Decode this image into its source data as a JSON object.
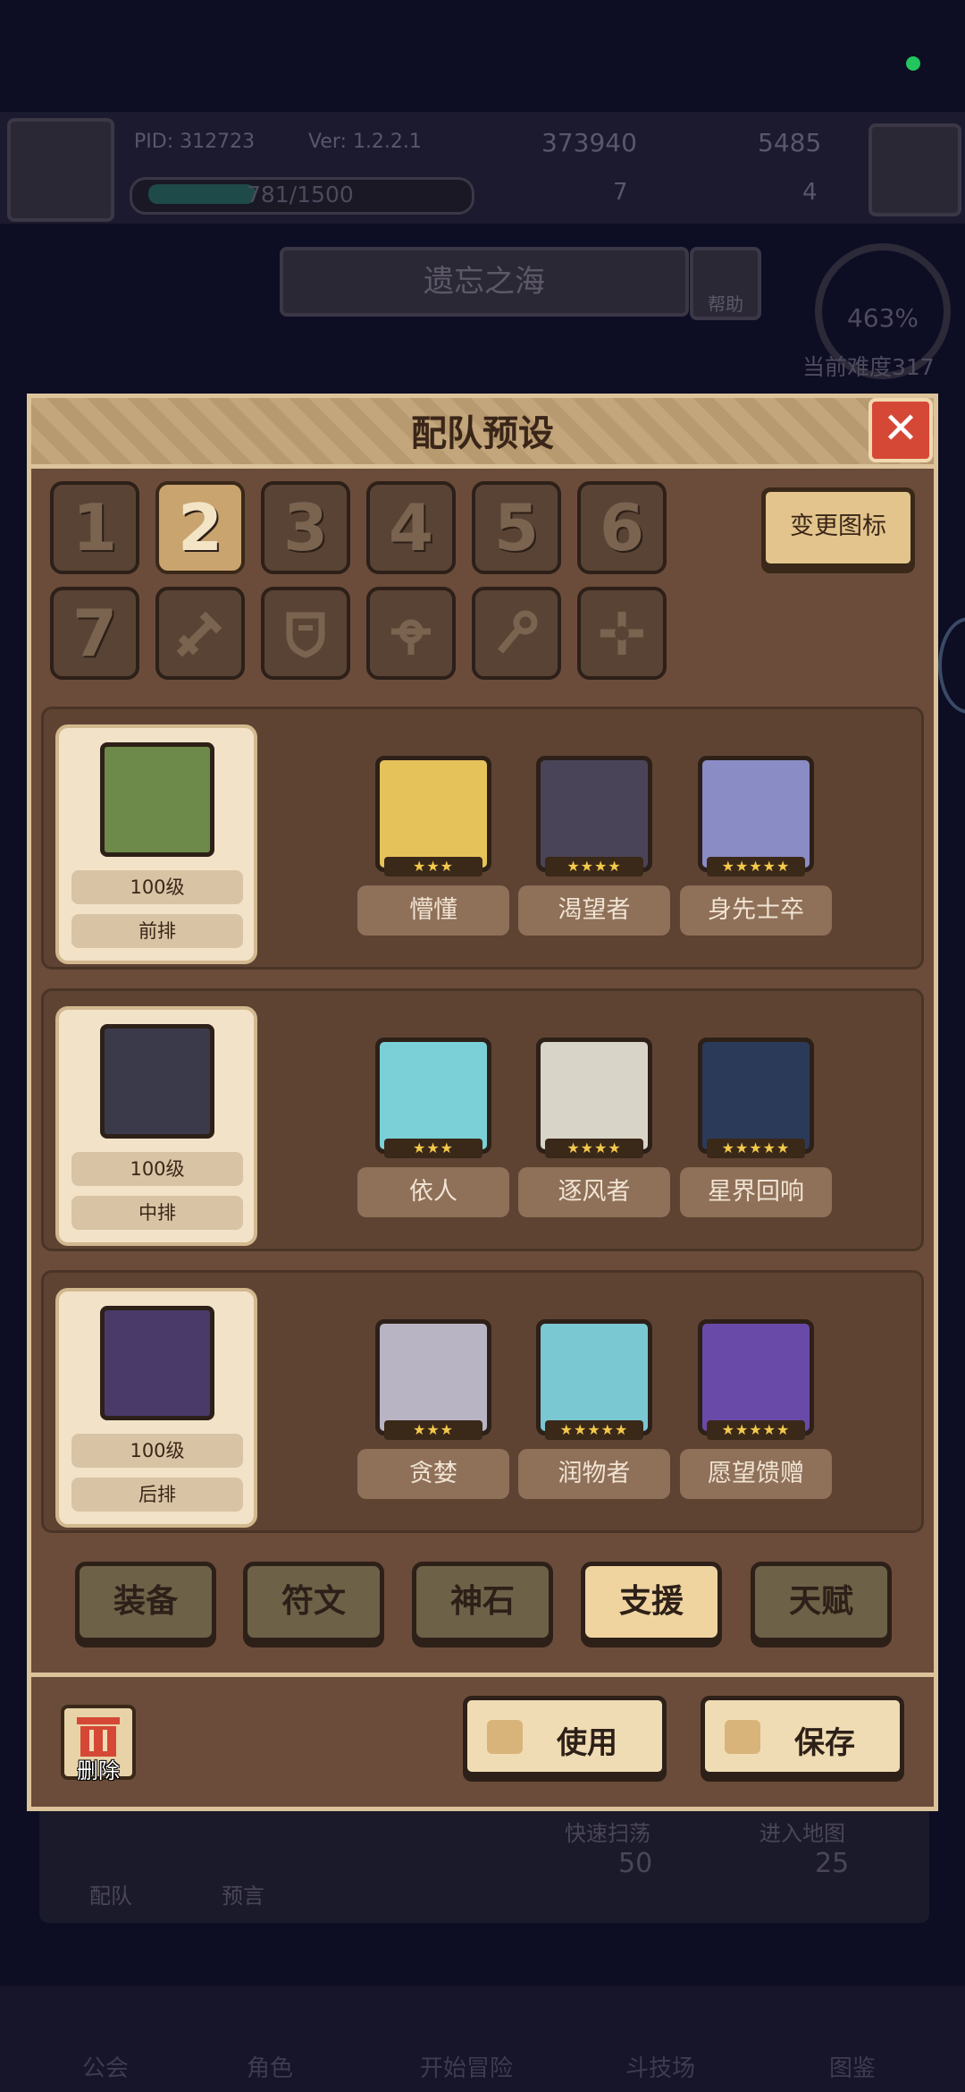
{
  "status": {
    "indicator_color": "#22c55e"
  },
  "background": {
    "player_id": "PID: 312723",
    "version": "Ver: 1.2.2.1",
    "gold": "373940",
    "gems": "5485",
    "exp": "781/1500",
    "stat_a": "7",
    "stat_b": "4",
    "map_name": "遗忘之海",
    "help_label": "帮助",
    "difficulty_percent": "463%",
    "difficulty_label": "当前难度317",
    "team_label": "配队",
    "prophecy_label": "预言",
    "quick_sweep": {
      "label": "快速扫荡",
      "cost": "50"
    },
    "enter_map": {
      "label": "进入地图",
      "cost": "25"
    },
    "nav": [
      "公会",
      "角色",
      "开始冒险",
      "斗技场",
      "图鉴"
    ]
  },
  "modal": {
    "title": "配队预设",
    "change_icon_label": "变更图标",
    "preset_slots": [
      "1",
      "2",
      "3",
      "4",
      "5",
      "6"
    ],
    "selected_slot": "2",
    "icon_slots": [
      "7",
      "sword-icon",
      "shield-icon",
      "cross-icon",
      "staff-icon",
      "star-cross-icon"
    ],
    "rows": [
      {
        "level": "100级",
        "position": "前排",
        "portrait_color": "#6e8a4a",
        "heroes": [
          {
            "name": "懵懂",
            "stars": "★★★",
            "color": "#e6c25a"
          },
          {
            "name": "渴望者",
            "stars": "★★★★",
            "color": "#4a4458"
          },
          {
            "name": "身先士卒",
            "stars": "★★★★★",
            "color": "#8a8cc6"
          }
        ]
      },
      {
        "level": "100级",
        "position": "中排",
        "portrait_color": "#3a3a4a",
        "heroes": [
          {
            "name": "依人",
            "stars": "★★★",
            "color": "#7ad0d6"
          },
          {
            "name": "逐风者",
            "stars": "★★★★",
            "color": "#d8d4c8"
          },
          {
            "name": "星界回响",
            "stars": "★★★★★",
            "color": "#2c3a5a"
          }
        ]
      },
      {
        "level": "100级",
        "position": "后排",
        "portrait_color": "#4a3a6a",
        "heroes": [
          {
            "name": "贪婪",
            "stars": "★★★",
            "color": "#b8b4c4"
          },
          {
            "name": "润物者",
            "stars": "★★★★★",
            "color": "#7ac8d2"
          },
          {
            "name": "愿望馈赠",
            "stars": "★★★★★",
            "color": "#6a4aa8"
          }
        ]
      }
    ],
    "tabs": [
      "装备",
      "符文",
      "神石",
      "支援",
      "天赋"
    ],
    "selected_tab": "支援",
    "delete_label": "删除",
    "use_label": "使用",
    "save_label": "保存"
  }
}
